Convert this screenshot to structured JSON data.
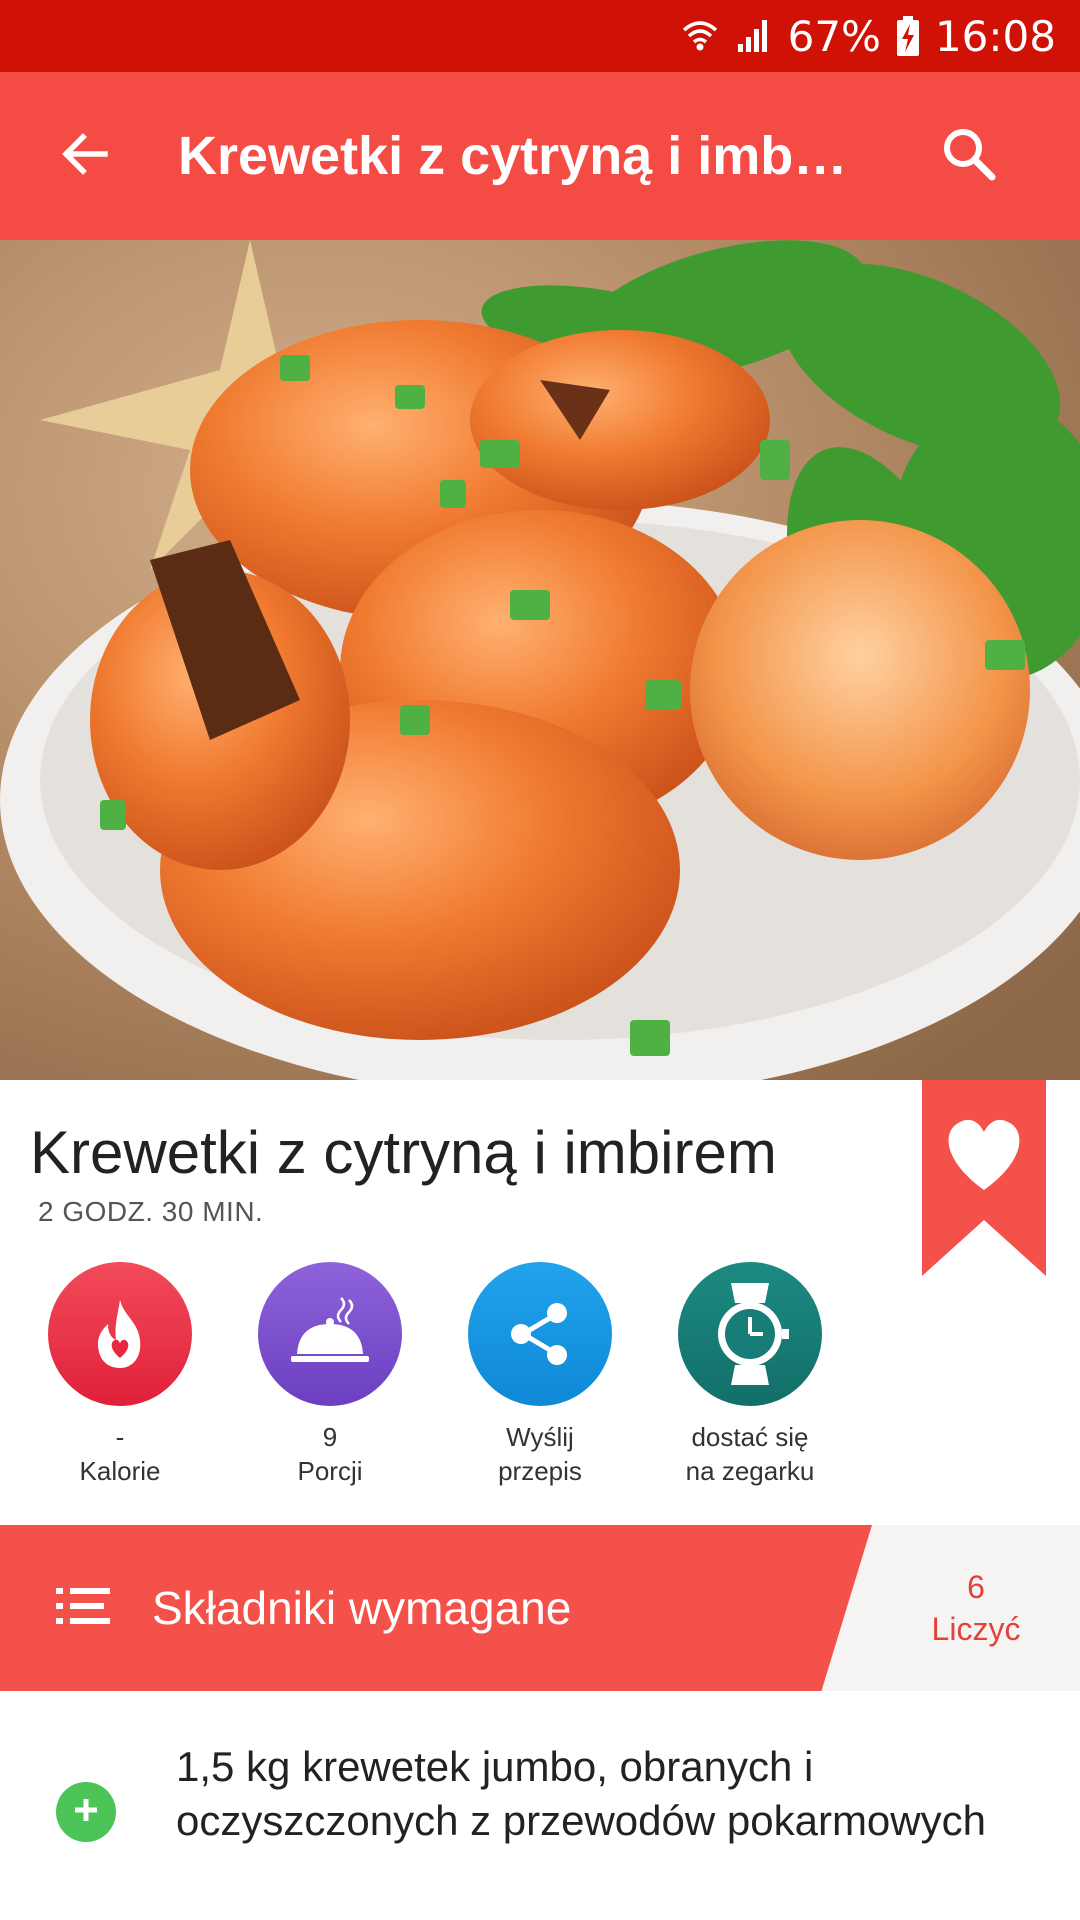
{
  "status_bar": {
    "battery_percent": "67%",
    "time": "16:08"
  },
  "app_bar": {
    "title": "Krewetki z cytryną i imbirem",
    "back_icon": "arrow-back-icon",
    "search_icon": "search-icon"
  },
  "hero": {
    "image_desc_icon": "recipe-photo"
  },
  "recipe": {
    "title": "Krewetki z cytryną i imbirem",
    "time": "2 GODZ. 30 MIN.",
    "favorite_icon": "heart-icon"
  },
  "actions": [
    {
      "icon": "calories-flame-icon",
      "line1": "-",
      "line2": "Kalorie",
      "color": "#e8283e"
    },
    {
      "icon": "serving-cloche-icon",
      "line1": "9",
      "line2": "Porcji",
      "color": "#7b4fcd"
    },
    {
      "icon": "share-icon",
      "line1": "Wyślij",
      "line2": "przepis",
      "color": "#1898e2"
    },
    {
      "icon": "watch-icon",
      "line1": "dostać się",
      "line2": "na zegarku",
      "color": "#177d76"
    }
  ],
  "ingredients": {
    "title": "Składniki wymagane",
    "count": "6",
    "count_label": "Liczyć",
    "items": [
      {
        "text": "1,5 kg krewetek jumbo, obranych i oczyszczonych z przewodów pokarmowych"
      }
    ]
  },
  "colors": {
    "status_bar": "#d01206",
    "app_bar": "#f44c45",
    "accent": "#f4514b",
    "add_green": "#4cc457"
  }
}
